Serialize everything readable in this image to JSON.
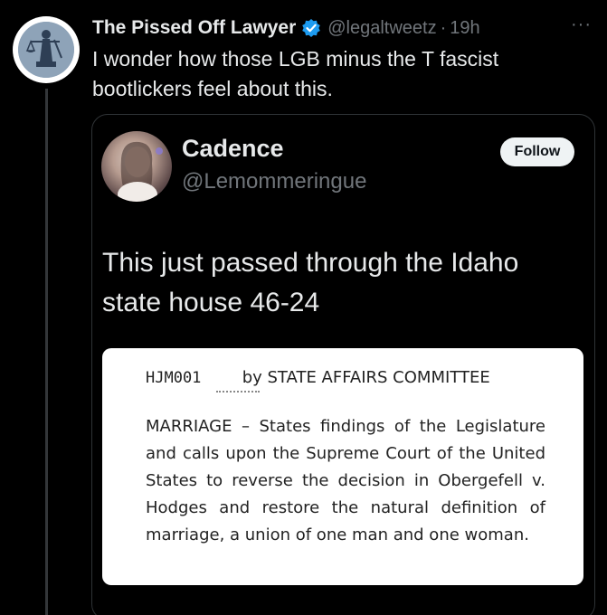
{
  "tweet": {
    "display_name": "The Pissed Off Lawyer",
    "handle": "@legaltweetz",
    "separator": "·",
    "time": "19h",
    "more": "···",
    "text": "I wonder how those LGB minus the T fascist bootlickers feel about this."
  },
  "quote": {
    "display_name": "Cadence",
    "handle": "@Lemommeringue",
    "follow_label": "Follow",
    "text": "This just passed through the Idaho state house 46-24",
    "document": {
      "code": "HJM001",
      "committee": "by STATE AFFAIRS COMMITTEE",
      "body": "MARRIAGE – States findings of the Legislature and calls upon the Supreme Court of the United States to reverse the decision in Obergefell v. Hodges and restore the natural definition of marriage, a union of one man and one woman."
    }
  },
  "colors": {
    "background": "#000000",
    "primary_text": "#e7e9ea",
    "secondary_text": "#71767b",
    "verified_blue": "#1d9bf0",
    "follow_bg": "#eff3f4"
  },
  "icons": {
    "verified": "verified-badge-icon",
    "more": "more-options-icon",
    "avatar_logo": "lady-justice-logo"
  }
}
